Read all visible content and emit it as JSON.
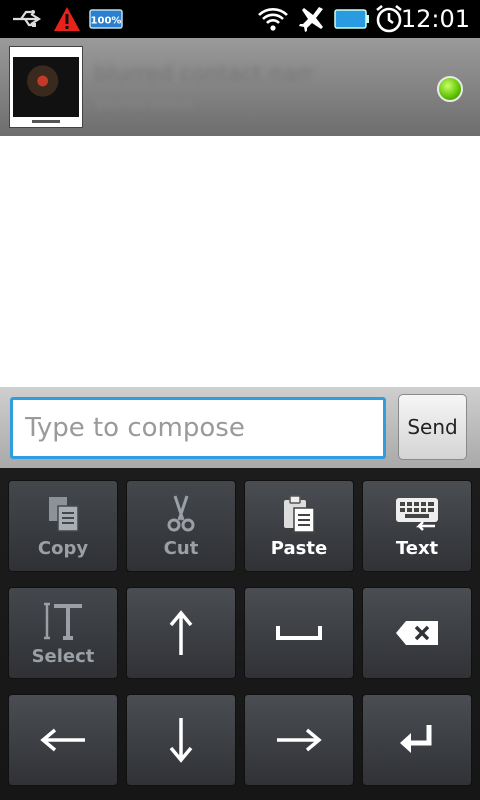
{
  "status_bar": {
    "time": "12:01",
    "battery_badge": "100%",
    "icons": [
      "usb-icon",
      "warning-icon",
      "battery-badge-icon",
      "wifi-icon",
      "airplane-icon",
      "battery-icon",
      "alarm-icon"
    ]
  },
  "conversation": {
    "contact_name": "blurred contact name",
    "contact_status": "blurred status",
    "presence_color": "#5cc200"
  },
  "compose": {
    "placeholder": "Type to compose",
    "send_label": "Send",
    "focus_color": "#2f9de0"
  },
  "keypad": {
    "copy_label": "Copy",
    "cut_label": "Cut",
    "paste_label": "Paste",
    "text_label": "Text",
    "select_label": "Select"
  }
}
